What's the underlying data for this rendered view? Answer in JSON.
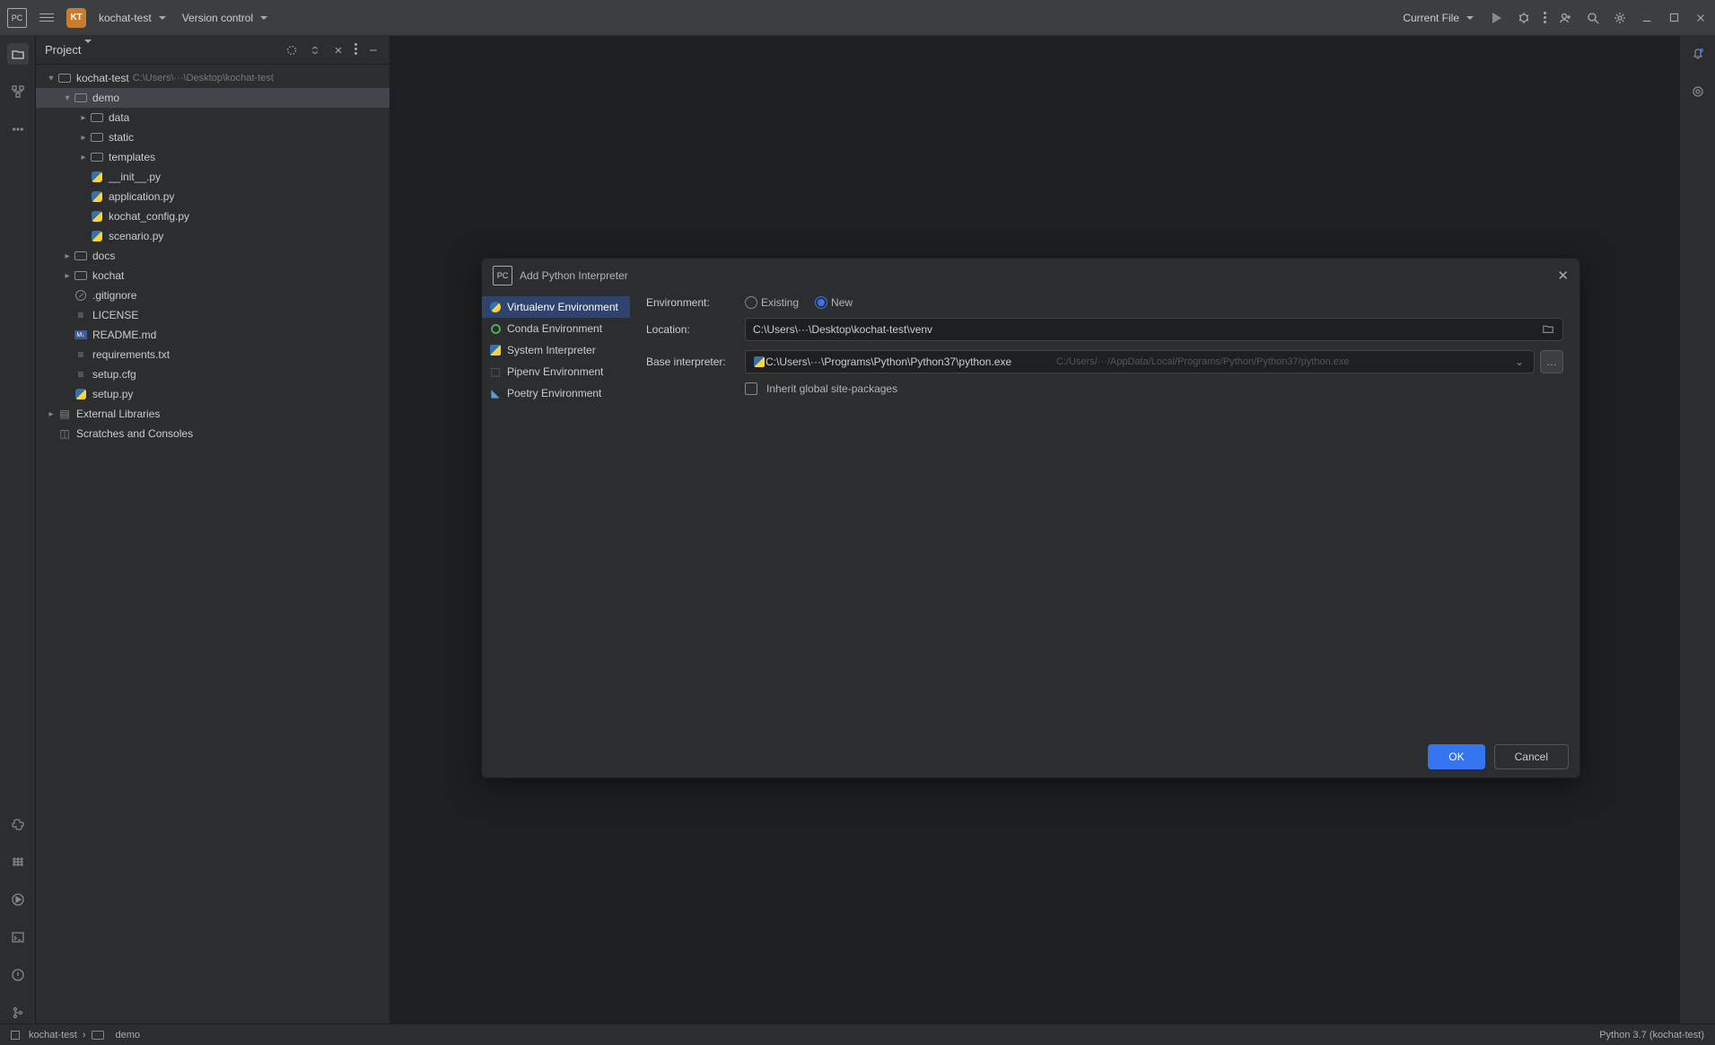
{
  "topbar": {
    "logo": "PC",
    "proj_badge": "KT",
    "proj_name": "kochat-test",
    "vcs_label": "Version control",
    "current_file": "Current File"
  },
  "toolwindow": {
    "title": "Project"
  },
  "tree": {
    "root": {
      "name": "kochat-test",
      "path": "C:\\Users\\···\\Desktop\\kochat-test"
    },
    "demo": "demo",
    "data": "data",
    "static": "static",
    "templates": "templates",
    "init_py": "__init__.py",
    "application_py": "application.py",
    "kochat_config_py": "kochat_config.py",
    "scenario_py": "scenario.py",
    "docs": "docs",
    "kochat": "kochat",
    "gitignore": ".gitignore",
    "license": "LICENSE",
    "readme": "README.md",
    "requirements": "requirements.txt",
    "setup_cfg": "setup.cfg",
    "setup_py": "setup.py",
    "ext_libs": "External Libraries",
    "scratches": "Scratches and Consoles"
  },
  "breadcrumbs": {
    "root": "kochat-test",
    "leaf": "demo"
  },
  "statusbar": {
    "interpreter": "Python 3.7 (kochat-test)"
  },
  "dialog": {
    "title": "Add Python Interpreter",
    "nav": {
      "virtualenv": "Virtualenv Environment",
      "conda": "Conda Environment",
      "system": "System Interpreter",
      "pipenv": "Pipenv Environment",
      "poetry": "Poetry Environment"
    },
    "form": {
      "env_label": "Environment:",
      "existing": "Existing",
      "new": "New",
      "location_label": "Location:",
      "location_value": "C:\\Users\\···\\Desktop\\kochat-test\\venv",
      "base_label": "Base interpreter:",
      "base_value": "C:\\Users\\···\\Programs\\Python\\Python37\\python.exe",
      "base_hint": "C:/Users/···/AppData/Local/Programs/Python/Python37/python.exe",
      "inherit": "Inherit global site-packages",
      "browse": "…"
    },
    "ok": "OK",
    "cancel": "Cancel"
  }
}
